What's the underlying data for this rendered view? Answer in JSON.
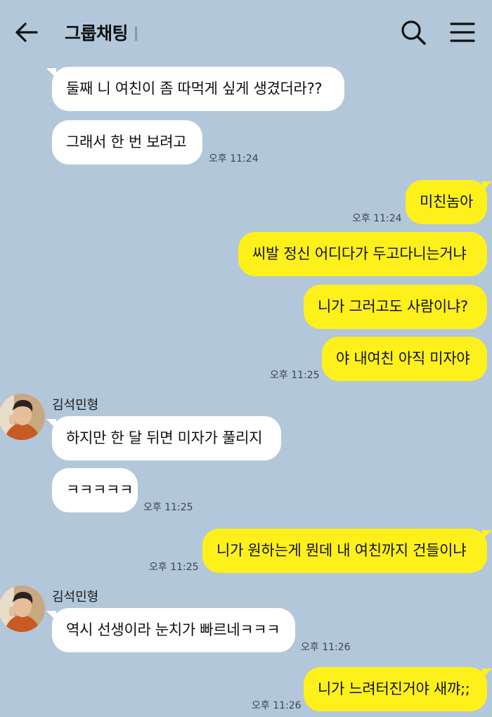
{
  "header": {
    "title": "그룹채팅",
    "back_icon": "arrow-left-icon",
    "search_icon": "search-icon",
    "menu_icon": "hamburger-menu-icon"
  },
  "colors": {
    "background": "#b2c7da",
    "incoming_bubble": "#ffffff",
    "outgoing_bubble": "#fef01b"
  },
  "messages": [
    {
      "direction": "in",
      "text": "둘째 니 여친이 좀 따먹게 싶게 생겼더라??",
      "time": ""
    },
    {
      "direction": "in",
      "text": "그래서 한 번 보려고",
      "time": "오후 11:24"
    },
    {
      "direction": "out",
      "text": "미친놈아",
      "time": "오후 11:24"
    },
    {
      "direction": "out",
      "text": "씨발 정신 어디다가 두고다니는거냐",
      "time": ""
    },
    {
      "direction": "out",
      "text": "니가 그러고도 사람이냐?",
      "time": ""
    },
    {
      "direction": "out",
      "text": "야 내여친 아직 미자야",
      "time": "오후 11:25"
    },
    {
      "direction": "in",
      "sender": "김석민형",
      "text": "하지만 한 달 뒤면 미자가 풀리지",
      "time": ""
    },
    {
      "direction": "in",
      "text": "ㅋㅋㅋㅋㅋ",
      "time": "오후 11:25"
    },
    {
      "direction": "out",
      "text": "니가 원하는게 뭔데 내 여친까지 건들이냐",
      "time": "오후 11:25"
    },
    {
      "direction": "in",
      "sender": "김석민형",
      "text": "역시 선생이라 눈치가 빠르네ㅋㅋㅋ",
      "time": "오후 11:26"
    },
    {
      "direction": "out",
      "text": "니가 느려터진거야 새꺄;;",
      "time": "오후 11:26"
    }
  ]
}
